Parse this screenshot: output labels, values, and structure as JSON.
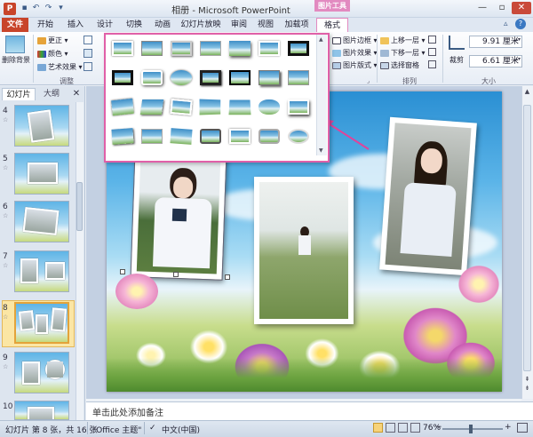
{
  "title_bar": {
    "title": "相册 - Microsoft PowerPoint",
    "app_logo": "P",
    "quick_access": [
      "save-icon",
      "undo-icon",
      "redo-icon",
      "customize-icon"
    ],
    "context_tab": "图片工具"
  },
  "tabs": [
    "文件",
    "开始",
    "插入",
    "设计",
    "切换",
    "动画",
    "幻灯片放映",
    "审阅",
    "视图",
    "加载项",
    "格式"
  ],
  "ribbon": {
    "remove_bg": "删除背景",
    "adjust": {
      "corrections": "更正 ▾",
      "color": "颜色 ▾",
      "artistic": "艺术效果 ▾",
      "label": "调整"
    },
    "picture_style": {
      "border": "图片边框 ▾",
      "effects": "图片效果 ▾",
      "layout": "图片版式 ▾"
    },
    "arrange": {
      "forward": "上移一层 ▾",
      "backward": "下移一层 ▾",
      "pane": "选择窗格",
      "label": "排列"
    },
    "size": {
      "crop": "裁剪",
      "height": "9.91 厘米",
      "width": "6.61 厘米",
      "label": "大小"
    }
  },
  "panel": {
    "tab_slides": "幻灯片",
    "tab_outline": "大纲",
    "close": "✕",
    "slide_numbers": [
      "4",
      "5",
      "6",
      "7",
      "8",
      "9",
      "10"
    ]
  },
  "notes": {
    "placeholder": "单击此处添加备注"
  },
  "status": {
    "slide_info": "幻灯片 第 8 张，共 16 张",
    "theme": "\"Office 主题\"",
    "language": "中文(中国)",
    "zoom": "76%"
  },
  "colors": {
    "accent": "#e060a8",
    "file_tab": "#c8442a",
    "ribbon_bg": "#e7edf5"
  }
}
